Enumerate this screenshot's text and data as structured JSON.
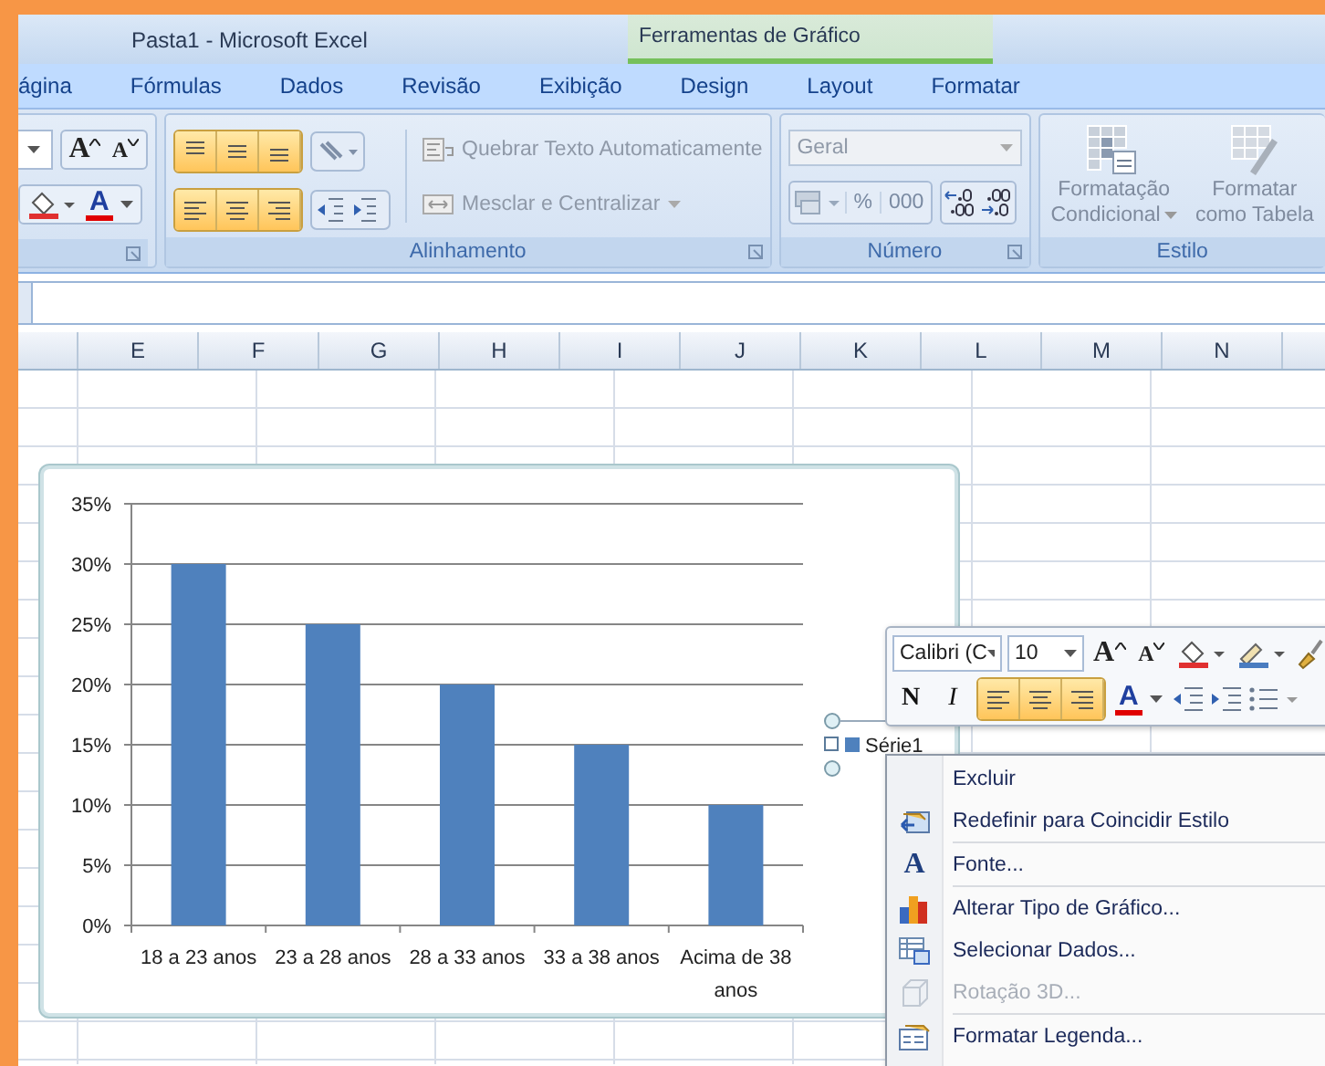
{
  "window": {
    "title": "Pasta1 - Microsoft Excel",
    "context_tab_group": "Ferramentas de Gráfico"
  },
  "tabs": [
    {
      "label": "ágina",
      "selected": false
    },
    {
      "label": "Fórmulas",
      "selected": false
    },
    {
      "label": "Dados",
      "selected": false
    },
    {
      "label": "Revisão",
      "selected": false
    },
    {
      "label": "Exibição",
      "selected": false
    },
    {
      "label": "Design",
      "selected": false
    },
    {
      "label": "Layout",
      "selected": false
    },
    {
      "label": "Formatar",
      "selected": false
    }
  ],
  "ribbon": {
    "font": {
      "grow_font": "A",
      "shrink_font": "A",
      "font_color": "A"
    },
    "alignment": {
      "group_label": "Alinhamento",
      "vertical_align": [
        {
          "selected": true
        },
        {
          "selected": true
        },
        {
          "selected": true
        }
      ],
      "horizontal_align": [
        {
          "selected": true
        },
        {
          "selected": true
        },
        {
          "selected": true
        }
      ],
      "wrap_text": {
        "label": "Quebrar Texto Automaticamente",
        "disabled": true
      },
      "merge": {
        "label": "Mesclar e Centralizar",
        "disabled": true
      }
    },
    "number": {
      "group_label": "Número",
      "format": {
        "value": "Geral",
        "disabled": true
      },
      "buttons": [
        "%",
        "000"
      ]
    },
    "style": {
      "group_label": "Estilo",
      "buttons": [
        {
          "lines": [
            "Formatação",
            "Condicional"
          ]
        },
        {
          "lines": [
            "Formatar",
            "como Tabela"
          ]
        }
      ]
    }
  },
  "sheet": {
    "columns": [
      "E",
      "F",
      "G",
      "H",
      "I",
      "J",
      "K",
      "L",
      "M",
      "N"
    ]
  },
  "chart": {
    "chart_data": {
      "type": "bar",
      "grid": true,
      "categories": [
        "18 a 23 anos",
        "23 a 28 anos",
        "28 a 33 anos",
        "33 a 38 anos",
        "Acima de 38 anos"
      ],
      "series": [
        {
          "name": "Série1",
          "color": "#4f81bd",
          "values": [
            30,
            25,
            20,
            15,
            10
          ]
        }
      ],
      "ylim": [
        0,
        35
      ],
      "yticks": [
        {
          "value": 0,
          "label": "0%"
        },
        {
          "value": 5,
          "label": "5%"
        },
        {
          "value": 10,
          "label": "10%"
        },
        {
          "value": 15,
          "label": "15%"
        },
        {
          "value": 20,
          "label": "20%"
        },
        {
          "value": 25,
          "label": "25%"
        },
        {
          "value": 30,
          "label": "30%"
        },
        {
          "value": 35,
          "label": "35%"
        }
      ]
    }
  },
  "mini_toolbar": {
    "font": "Calibri (C",
    "size": "10",
    "grow_font": "A",
    "shrink_font": "A",
    "bold": "N",
    "italic": "I",
    "font_color": "A",
    "align_buttons": [
      {
        "selected": true
      },
      {
        "selected": true
      },
      {
        "selected": true
      }
    ]
  },
  "context_menu": {
    "items": [
      {
        "label": "Excluir",
        "disabled": false,
        "separator_before": false
      },
      {
        "label": "Redefinir para Coincidir Estilo",
        "disabled": false,
        "separator_before": false
      },
      {
        "label": "Fonte...",
        "icon_text": "A",
        "disabled": false,
        "separator_before": true
      },
      {
        "label": "Alterar Tipo de Gráfico...",
        "disabled": false,
        "separator_before": true
      },
      {
        "label": "Selecionar Dados...",
        "disabled": false,
        "separator_before": false
      },
      {
        "label": "Rotação 3D...",
        "disabled": true,
        "separator_before": false
      },
      {
        "label": "Formatar Legenda...",
        "disabled": false,
        "separator_before": true
      }
    ]
  }
}
